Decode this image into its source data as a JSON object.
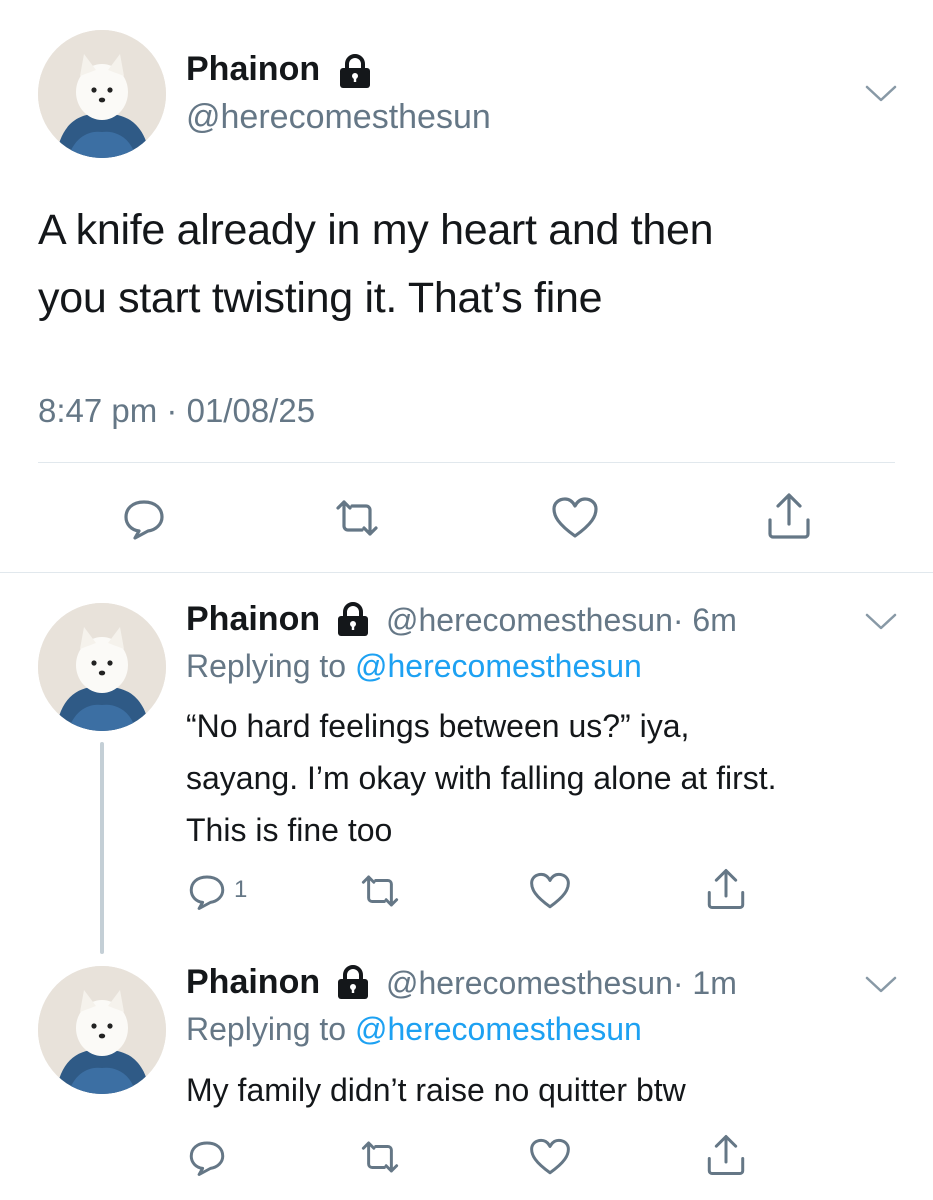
{
  "main_tweet": {
    "display_name": "Phainon",
    "handle": "@herecomesthesun",
    "text_line1": "A knife already in my heart and then",
    "text_line2": "you start twisting it. That’s fine",
    "time": "8:47 pm",
    "separator": "·",
    "date": "01/08/25"
  },
  "replies": [
    {
      "display_name": "Phainon",
      "handle": "@herecomesthesun",
      "time_ago": "· 6m",
      "replying_prefix": "Replying to",
      "replying_handle": "@herecomesthesun",
      "text_line1": "“No hard feelings between us?” iya,",
      "text_line2": "sayang. I’m okay with falling alone at first.",
      "text_line3": "This is fine too",
      "reply_count": "1"
    },
    {
      "display_name": "Phainon",
      "handle": "@herecomesthesun",
      "time_ago": "· 1m",
      "replying_prefix": "Replying to",
      "replying_handle": "@herecomesthesun",
      "text_line1": "My family didn’t raise no quitter btw"
    }
  ],
  "icons": {
    "lock": "lock-icon",
    "chevron": "chevron-down-icon",
    "reply": "reply-icon",
    "retweet": "retweet-icon",
    "like": "heart-icon",
    "share": "share-icon"
  },
  "colors": {
    "link": "#1da1f2",
    "secondary_text": "#657786",
    "icon": "#657786",
    "divider": "#e1e8ed"
  }
}
